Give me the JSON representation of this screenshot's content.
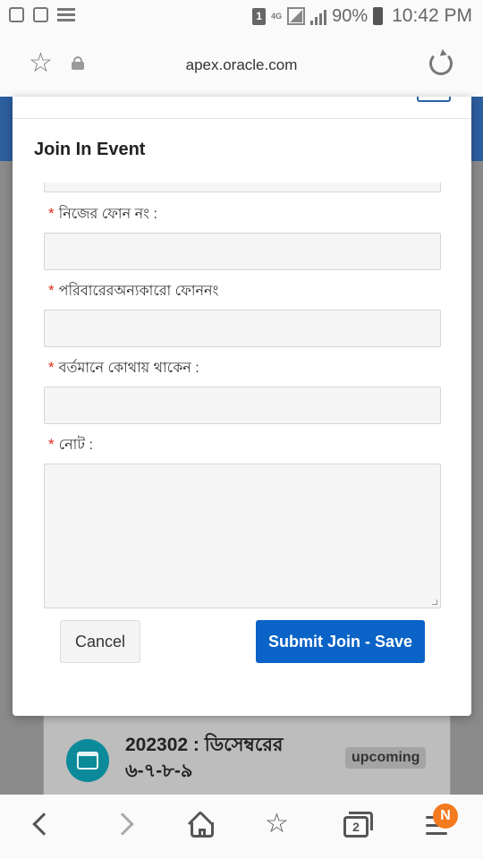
{
  "status_bar": {
    "sim_label": "1",
    "network": "4G",
    "battery": "90%",
    "time": "10:42 PM"
  },
  "browser": {
    "url": "apex.oracle.com",
    "icons": [
      "star-icon",
      "lock-icon",
      "reload-icon"
    ]
  },
  "modal": {
    "title": "Join In Event",
    "fields": [
      {
        "label": "নিজের ফোন নং :",
        "value": "",
        "required": true
      },
      {
        "label": "পরিবারেরঅন্যকারো ফোননং",
        "value": "",
        "required": true
      },
      {
        "label": "বর্তমানে কোথায় থাকেন :",
        "value": "",
        "required": true
      },
      {
        "label": "নোট :",
        "value": "",
        "required": true,
        "multiline": true
      }
    ],
    "required_marker": "*",
    "cancel_label": "Cancel",
    "submit_label": "Submit Join - Save"
  },
  "background_card": {
    "title": "202302 : ডিসেম্বরের ৬-৭-৮-৯",
    "badge": "upcoming"
  },
  "bottom_nav": {
    "tabs_count": "2",
    "menu_badge": "N"
  },
  "colors": {
    "primary_button": "#0a63c6",
    "required_marker": "#e02a1a",
    "header_strip": "#2d5e9e",
    "badge": "#f47a1f"
  }
}
